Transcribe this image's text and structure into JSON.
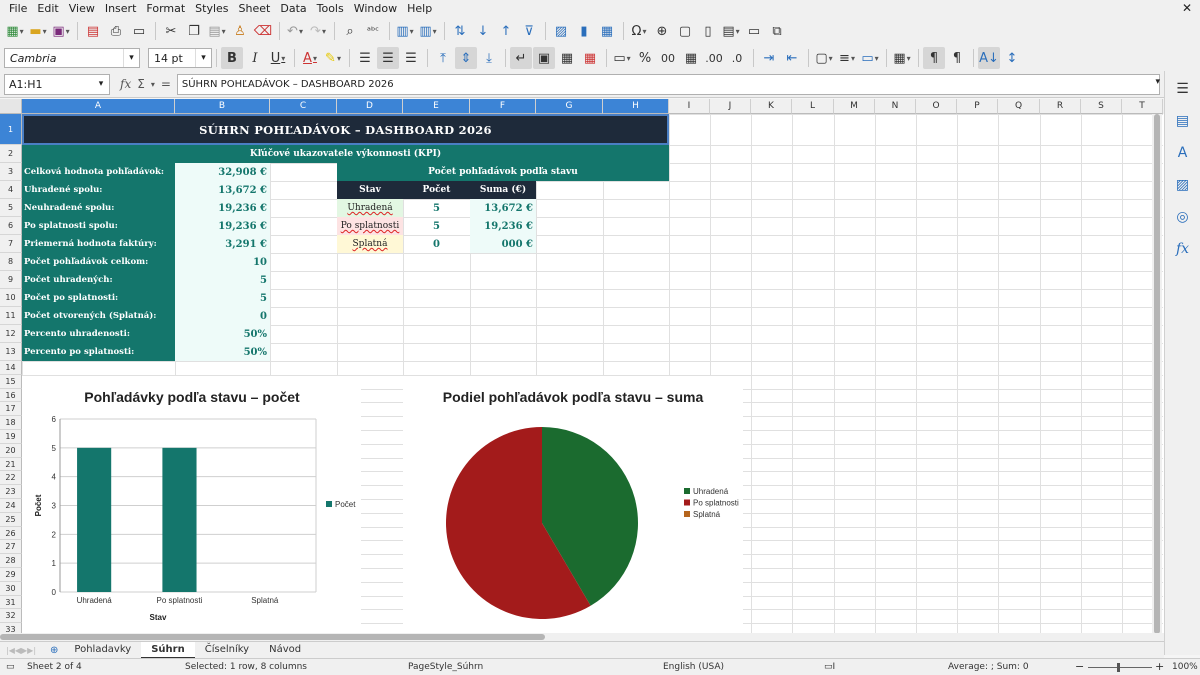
{
  "menu": [
    "File",
    "Edit",
    "View",
    "Insert",
    "Format",
    "Styles",
    "Sheet",
    "Data",
    "Tools",
    "Window",
    "Help"
  ],
  "toolbar": {
    "font_name": "Cambria",
    "font_size": "14 pt",
    "bold": "B",
    "italic": "I",
    "underline": "U",
    "percent": "%",
    "decimal_zero": "0.0",
    "add_decimal": ".00",
    "del_decimal": ".0"
  },
  "formula_bar": {
    "name_box": "A1:H1",
    "fx": "fx",
    "sigma": "Σ",
    "equals": "=",
    "content": "SÚHRN POHĽADÁVOK – DASHBOARD 2026"
  },
  "columns": [
    "A",
    "B",
    "C",
    "D",
    "E",
    "F",
    "G",
    "H",
    "I",
    "J",
    "K",
    "L",
    "M",
    "N",
    "O",
    "P",
    "Q",
    "R",
    "S",
    "T"
  ],
  "rows": [
    "1",
    "2",
    "3",
    "4",
    "5",
    "6",
    "7",
    "8",
    "9",
    "10",
    "11",
    "12",
    "13",
    "14",
    "15",
    "16",
    "17",
    "18",
    "19",
    "20",
    "21",
    "22",
    "23",
    "24",
    "25",
    "26",
    "27",
    "28",
    "29",
    "30",
    "31",
    "32",
    "33"
  ],
  "sheet": {
    "title": "SÚHRN POHĽADÁVOK – DASHBOARD 2026",
    "kpi_header": "Kľúčové ukazovatele výkonnosti (KPI)",
    "kpis": [
      {
        "label": "Celková hodnota pohľadávok:",
        "value": "32,908 €"
      },
      {
        "label": "Uhradené spolu:",
        "value": "13,672 €"
      },
      {
        "label": "Neuhradené spolu:",
        "value": "19,236 €"
      },
      {
        "label": "Po splatnosti spolu:",
        "value": "19,236 €"
      },
      {
        "label": "Priemerná hodnota faktúry:",
        "value": "3,291 €"
      },
      {
        "label": "Počet pohľadávok celkom:",
        "value": "10"
      },
      {
        "label": "Počet uhradených:",
        "value": "5"
      },
      {
        "label": "Počet po splatnosti:",
        "value": "5"
      },
      {
        "label": "Počet otvorených (Splatná):",
        "value": "0"
      },
      {
        "label": "Percento uhradenosti:",
        "value": "50%"
      },
      {
        "label": "Percento po splatnosti:",
        "value": "50%"
      }
    ],
    "status_header": "Počet pohľadávok podľa stavu",
    "status_cols": [
      "Stav",
      "Počet",
      "Suma (€)"
    ],
    "status_rows": [
      {
        "stav": "Uhradená",
        "pocet": "5",
        "suma": "13,672 €",
        "bg": "#e3f7e3"
      },
      {
        "stav": "Po splatnosti",
        "pocet": "5",
        "suma": "19,236 €",
        "bg": "#fde3e3"
      },
      {
        "stav": "Splatná",
        "pocet": "0",
        "suma": "000 €",
        "bg": "#fff8d6"
      }
    ]
  },
  "chart_data": [
    {
      "type": "bar",
      "title": "Pohľadávky podľa stavu – počet",
      "xlabel": "Stav",
      "ylabel": "Počet",
      "categories": [
        "Uhradená",
        "Po splatnosti",
        "Splatná"
      ],
      "series": [
        {
          "name": "Počet",
          "values": [
            5,
            5,
            0
          ],
          "color": "#14766c"
        }
      ],
      "ylim": [
        0,
        6
      ],
      "yticks": [
        "0",
        "1",
        "2",
        "3",
        "4",
        "5",
        "6"
      ],
      "legend": "right",
      "grid": true
    },
    {
      "type": "pie",
      "title": "Podiel pohľadávok podľa stavu – suma",
      "categories": [
        "Uhradená",
        "Po splatnosti",
        "Splatná"
      ],
      "values": [
        13672,
        19236,
        0
      ],
      "colors": [
        "#1b6b2f",
        "#a31b1b",
        "#b5651d"
      ],
      "legend": "right"
    }
  ],
  "tabs": [
    "Pohladavky",
    "Súhrn",
    "Číselníky",
    "Návod"
  ],
  "active_tab": "Súhrn",
  "status": {
    "sheet": "Sheet 2 of 4",
    "selection": "Selected: 1 row, 8 columns",
    "page_style": "PageStyle_Súhrn",
    "language": "English (USA)",
    "summary": "Average: ; Sum: 0",
    "zoom": "100%"
  },
  "colors": {
    "teal": "#14766c",
    "navy": "#1e2a3a",
    "selection": "#3c84d6"
  }
}
